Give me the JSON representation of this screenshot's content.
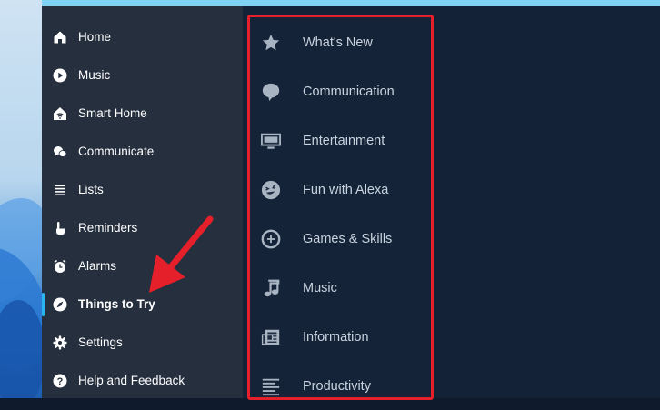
{
  "colors": {
    "sidebar_bg": "#252f3e",
    "main_bg": "#142238",
    "accent": "#2bb5f0",
    "highlight_border": "#e5202a",
    "annotation_arrow": "#e5202a"
  },
  "sidebar": {
    "items": [
      {
        "label": "Home",
        "icon": "home-icon"
      },
      {
        "label": "Music",
        "icon": "play-circle-icon"
      },
      {
        "label": "Smart Home",
        "icon": "smart-home-icon"
      },
      {
        "label": "Communicate",
        "icon": "chat-bubbles-icon"
      },
      {
        "label": "Lists",
        "icon": "list-icon"
      },
      {
        "label": "Reminders",
        "icon": "hand-pointer-icon"
      },
      {
        "label": "Alarms",
        "icon": "alarm-clock-icon"
      },
      {
        "label": "Things to Try",
        "icon": "compass-icon",
        "active": true
      },
      {
        "label": "Settings",
        "icon": "gear-icon"
      },
      {
        "label": "Help and Feedback",
        "icon": "help-icon"
      }
    ]
  },
  "things_to_try": {
    "categories": [
      {
        "label": "What's New",
        "icon": "star-icon"
      },
      {
        "label": "Communication",
        "icon": "speech-bubble-icon"
      },
      {
        "label": "Entertainment",
        "icon": "tv-icon"
      },
      {
        "label": "Fun with Alexa",
        "icon": "laughing-face-icon"
      },
      {
        "label": "Games & Skills",
        "icon": "game-dial-icon"
      },
      {
        "label": "Music",
        "icon": "music-note-icon"
      },
      {
        "label": "Information",
        "icon": "newspaper-icon"
      },
      {
        "label": "Productivity",
        "icon": "text-lines-icon"
      }
    ]
  }
}
